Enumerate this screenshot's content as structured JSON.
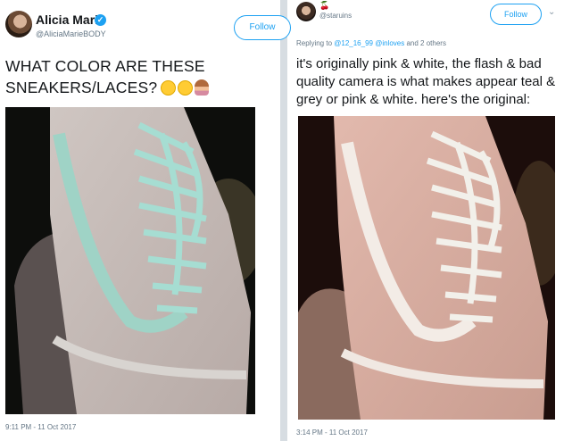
{
  "left_tweet": {
    "name": "Alicia Marie",
    "handle": "@AliciaMarieBODY",
    "follow_label": "Follow",
    "text": "WHAT COLOR ARE THESE SNEAKERS/LACES?",
    "emojis": [
      "rofl-emoji",
      "grimacing-emoji",
      "person-shrugging-emoji"
    ],
    "timestamp": "9:11 PM - 11 Oct 2017",
    "verified_color": "#1da1f2"
  },
  "right_tweet": {
    "name_symbol": "🍒",
    "handle": "@staruins",
    "follow_label": "Follow",
    "reply_prefix": "Replying to",
    "reply_handles": "@12_16_99 @inloves",
    "reply_suffix": "and 2 others",
    "text": "it's originally pink & white, the flash & bad quality camera is what makes appear teal & grey or pink & white. here's the original:",
    "timestamp": "3:14 PM - 11 Oct 2017"
  },
  "colors": {
    "accent": "#1da1f2",
    "text": "#14171a",
    "muted": "#657786"
  }
}
